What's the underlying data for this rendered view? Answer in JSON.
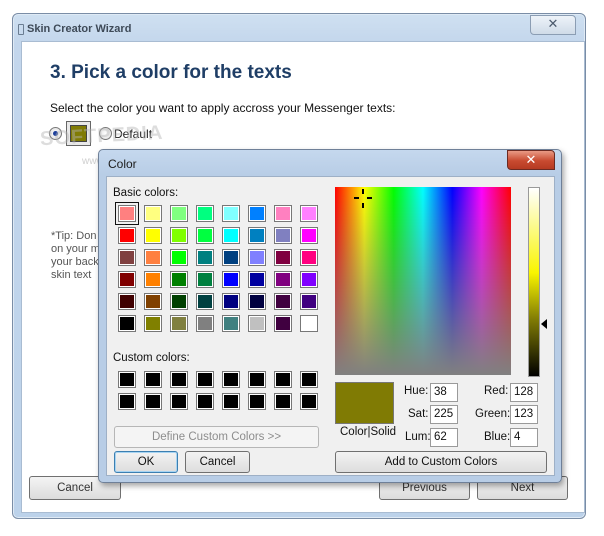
{
  "wizard": {
    "title": "Skin Creator Wizard",
    "close_glyph": "✕",
    "heading": "3. Pick a color for the texts",
    "description": "Select the color you want to apply accross your Messenger texts:",
    "options": {
      "custom_selected": true,
      "default_label": "Default"
    },
    "selected_color": "#807b04",
    "tip_lines": [
      "*Tip: Don",
      "on your m",
      "your back",
      "skin text"
    ],
    "buttons": {
      "cancel": "Cancel",
      "previous": "Previous",
      "next": "Next"
    },
    "watermark": "SOFTPEDIA",
    "watermark_sub": "www.softpedia.com"
  },
  "color_dialog": {
    "title": "Color",
    "close_glyph": "✕",
    "basic_colors_label": "Basic colors:",
    "custom_colors_label": "Custom colors:",
    "basic_colors": [
      [
        "#ff8080",
        "#ffff80",
        "#80ff80",
        "#00ff80",
        "#80ffff",
        "#0080ff",
        "#ff80c0",
        "#ff80ff"
      ],
      [
        "#ff0000",
        "#ffff00",
        "#80ff00",
        "#00ff40",
        "#00ffff",
        "#0080c0",
        "#8080c0",
        "#ff00ff"
      ],
      [
        "#804040",
        "#ff8040",
        "#00ff00",
        "#008080",
        "#004080",
        "#8080ff",
        "#800040",
        "#ff0080"
      ],
      [
        "#800000",
        "#ff8000",
        "#008000",
        "#008040",
        "#0000ff",
        "#0000a0",
        "#800080",
        "#8000ff"
      ],
      [
        "#400000",
        "#804000",
        "#004000",
        "#004040",
        "#000080",
        "#000040",
        "#400040",
        "#400080"
      ],
      [
        "#000000",
        "#808000",
        "#808040",
        "#808080",
        "#408080",
        "#c0c0c0",
        "#400040",
        "#ffffff"
      ]
    ],
    "selected_basic": [
      0,
      0
    ],
    "custom_colors": [
      [
        "#000000",
        "#000000",
        "#000000",
        "#000000",
        "#000000",
        "#000000",
        "#000000",
        "#000000"
      ],
      [
        "#000000",
        "#000000",
        "#000000",
        "#000000",
        "#000000",
        "#000000",
        "#000000",
        "#000000"
      ]
    ],
    "define_custom_label": "Define Custom Colors >>",
    "ok_label": "OK",
    "cancel_label": "Cancel",
    "color_solid_label": "Color|Solid",
    "hue_label": "Hue:",
    "hue": "38",
    "sat_label": "Sat:",
    "sat": "225",
    "lum_label": "Lum:",
    "lum": "62",
    "red_label": "Red:",
    "red": "128",
    "green_label": "Green:",
    "green": "123",
    "blue_label": "Blue:",
    "blue": "4",
    "add_custom_label": "Add to Custom Colors",
    "current_color": "#807b04"
  }
}
